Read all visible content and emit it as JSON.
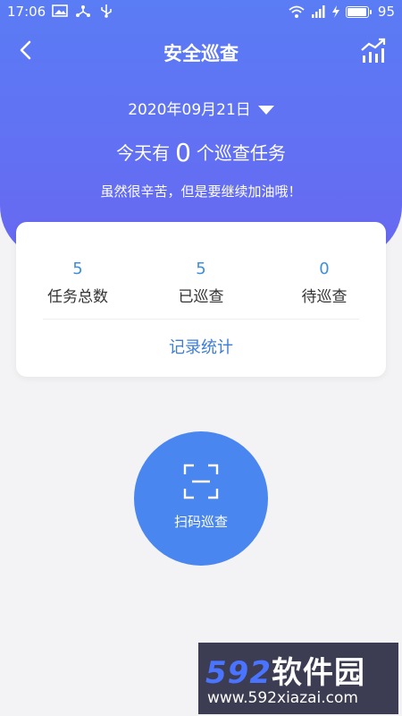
{
  "status_bar": {
    "time": "17:06",
    "battery": "95",
    "battery_level": 0.95
  },
  "navbar": {
    "title": "安全巡查"
  },
  "header": {
    "date": "2020年09月21日",
    "task_prefix": "今天有",
    "task_count": "0",
    "task_suffix": "个巡查任务",
    "encourage": "虽然很辛苦，但是要继续加油哦！"
  },
  "summary": {
    "stats": [
      {
        "value": "5",
        "label": "任务总数"
      },
      {
        "value": "5",
        "label": "已巡查"
      },
      {
        "value": "0",
        "label": "待巡查"
      }
    ],
    "record_link": "记录统计"
  },
  "scan": {
    "label": "扫码巡查"
  },
  "watermark": {
    "number": "592",
    "brand": "软件园",
    "url": "www.592xiazai.com"
  },
  "colors": {
    "header_gradient_top": "#5a7cf4",
    "header_gradient_bottom": "#6868f2",
    "accent": "#3d8ee0",
    "scan_button": "#4a86ef"
  }
}
